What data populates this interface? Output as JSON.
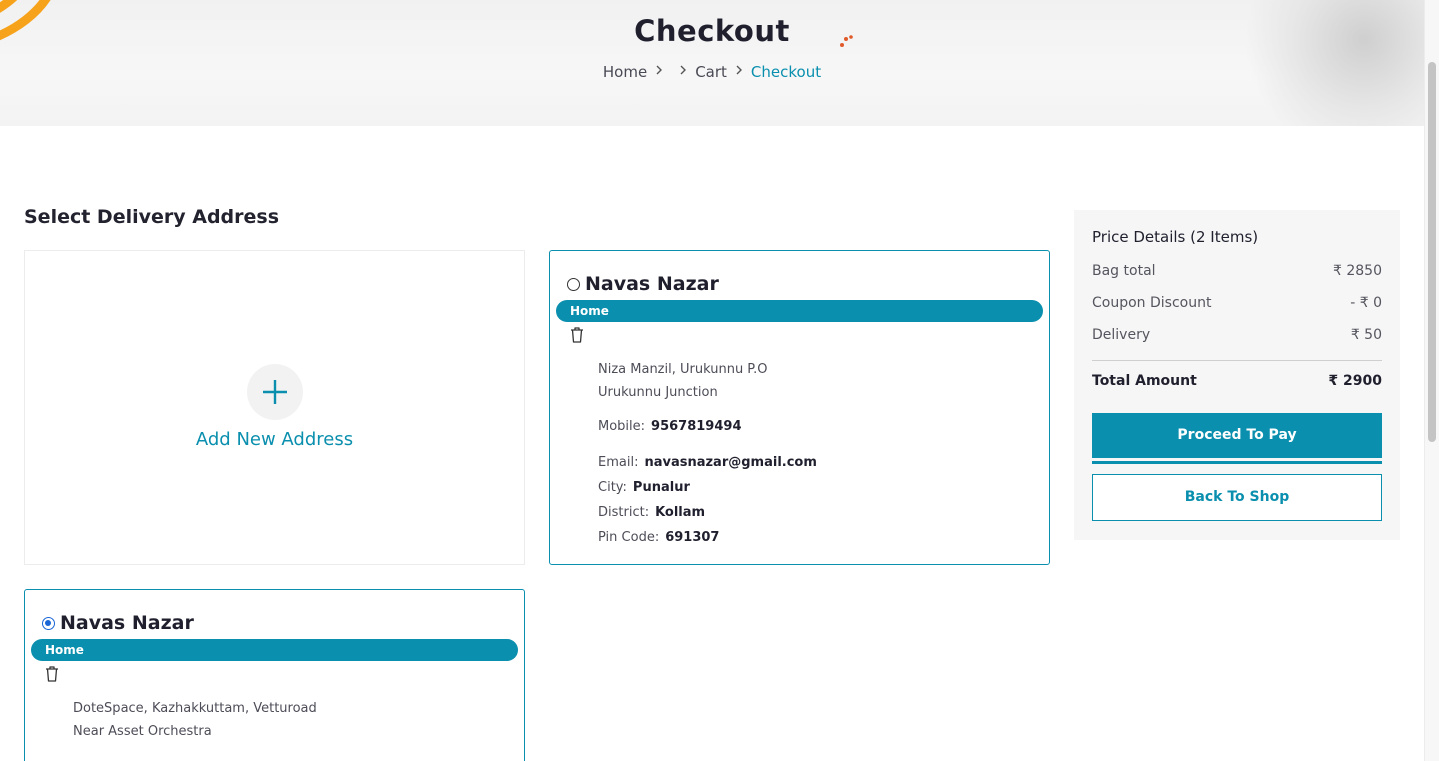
{
  "hero": {
    "title": "Checkout",
    "breadcrumb": [
      "Home",
      "Cart",
      "Checkout"
    ]
  },
  "section_title": "Select Delivery Address",
  "add_address": {
    "label": "Add New Address"
  },
  "addresses": [
    {
      "name": "Navas Nazar",
      "selected": false,
      "tag": "Home",
      "line1": "Niza Manzil, Urukunnu P.O",
      "line2": "Urukunnu Junction",
      "mobile_label": "Mobile:",
      "mobile": "9567819494",
      "email_label": "Email:",
      "email": "navasnazar@gmail.com",
      "city_label": "City:",
      "city": "Punalur",
      "district_label": "District:",
      "district": "Kollam",
      "pin_label": "Pin Code:",
      "pin": "691307"
    },
    {
      "name": "Navas Nazar",
      "selected": true,
      "tag": "Home",
      "line1": "DoteSpace, Kazhakkuttam, Vetturoad",
      "line2": "Near Asset Orchestra"
    }
  ],
  "price_details": {
    "title": "Price Details (2 Items)",
    "rows": [
      {
        "label": "Bag total",
        "value": "₹ 2850"
      },
      {
        "label": "Coupon Discount",
        "value": "- ₹ 0"
      },
      {
        "label": "Delivery",
        "value": "₹ 50"
      }
    ],
    "total_label": "Total Amount",
    "total_value": "₹ 2900",
    "pay_button": "Proceed To Pay",
    "shop_button": "Back To Shop"
  },
  "colors": {
    "accent": "#0a8fae",
    "radio_selected": "#1a66d6",
    "swirl": "#f7a21b"
  },
  "icons": [
    "plus-icon",
    "trash-icon",
    "chevron-right-icon"
  ]
}
